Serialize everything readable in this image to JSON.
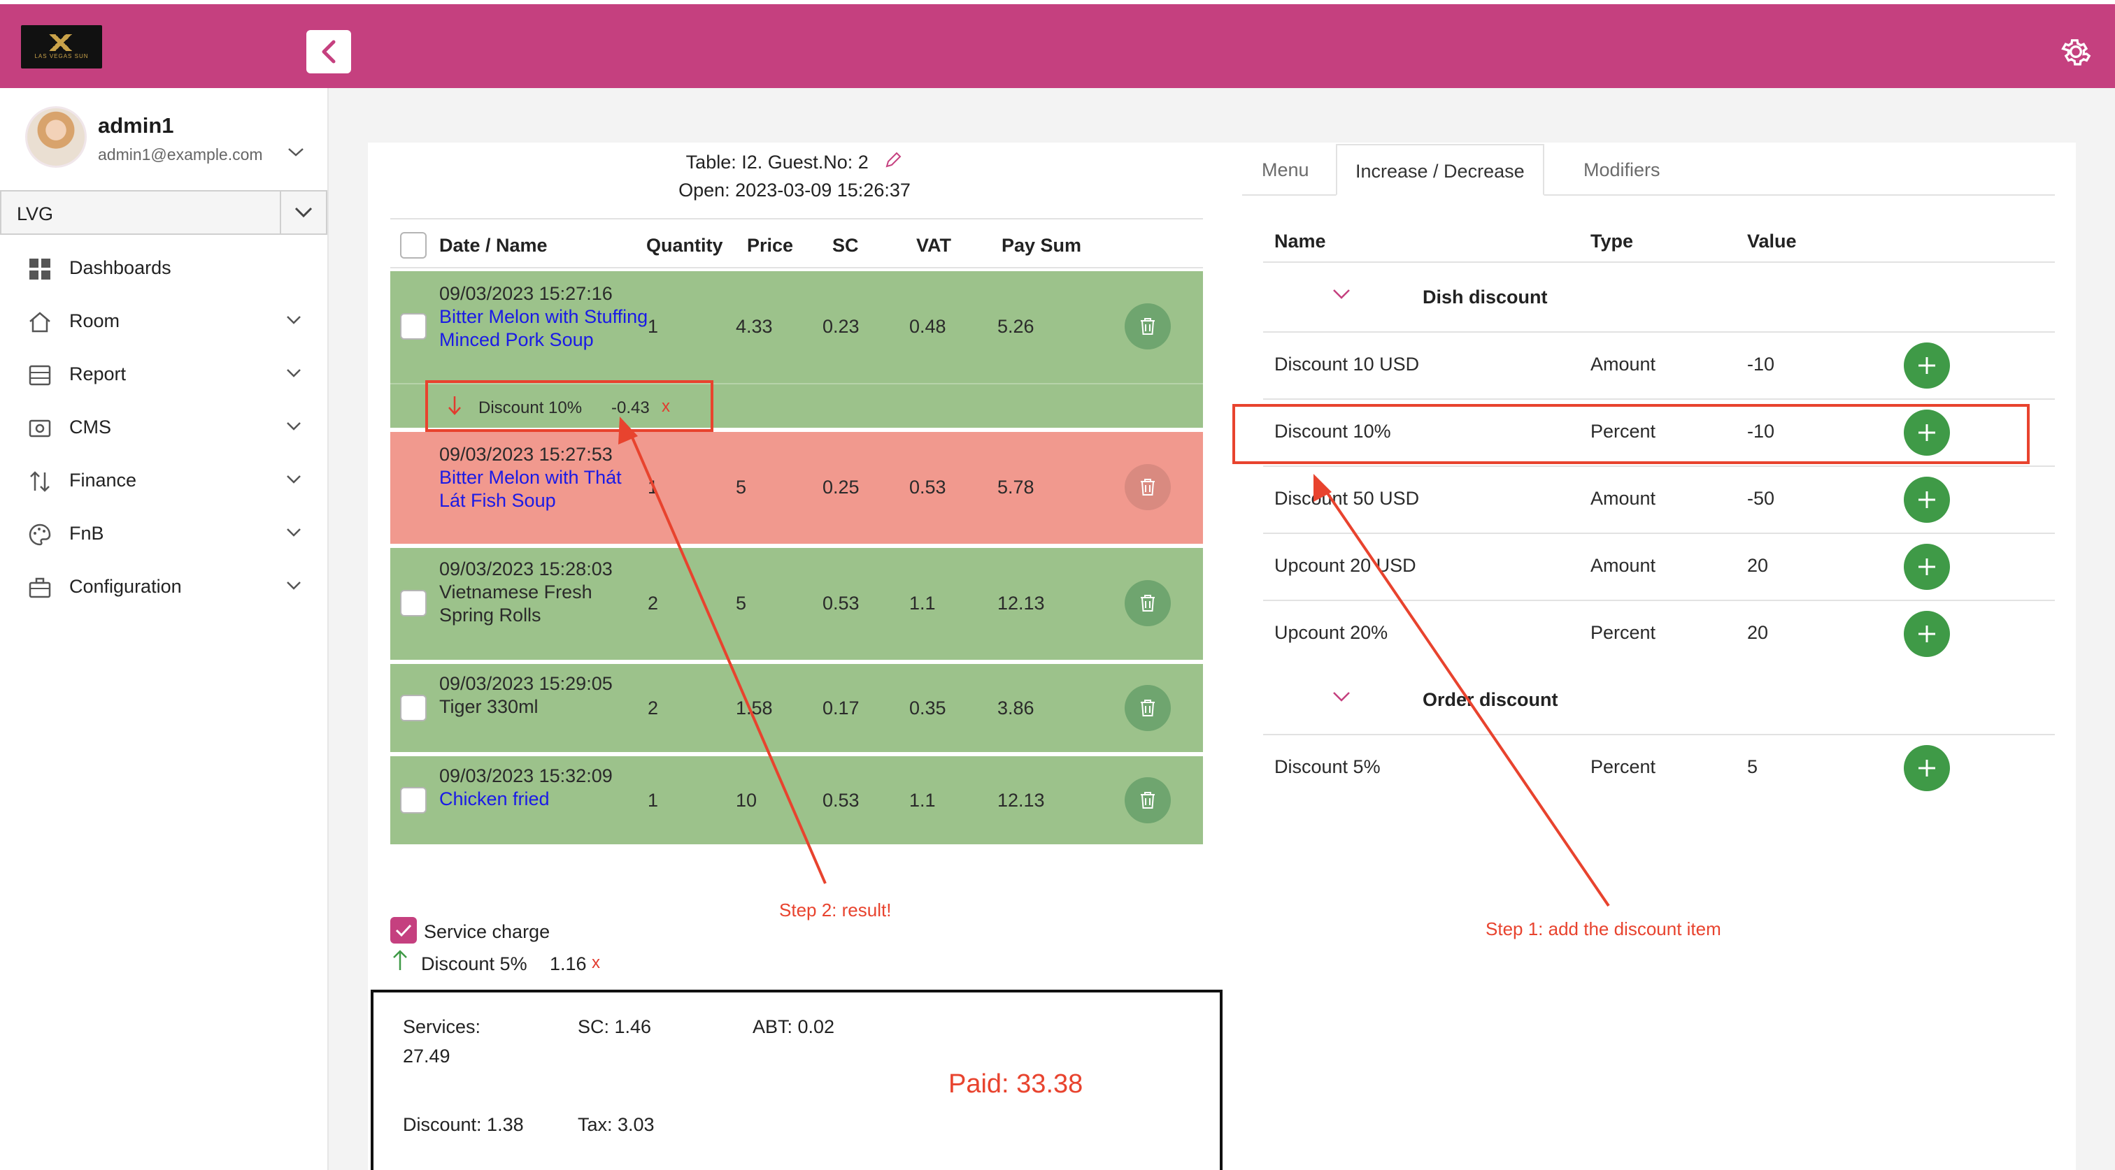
{
  "header": {
    "logo_text": "LAS VEGAS SUN",
    "colors": {
      "brand": "#c5407f",
      "row_green": "#9cc28b",
      "row_red": "#f1998e",
      "add_green": "#3f9a47",
      "annotation_red": "#e8432e",
      "link_blue": "#1a1ae6"
    }
  },
  "user": {
    "name": "admin1",
    "email": "admin1@example.com"
  },
  "org_select": {
    "value": "LVG"
  },
  "nav": [
    {
      "label": "Dashboards",
      "icon": "grid-icon"
    },
    {
      "label": "Room",
      "icon": "home-icon"
    },
    {
      "label": "Report",
      "icon": "report-icon"
    },
    {
      "label": "CMS",
      "icon": "image-icon"
    },
    {
      "label": "Finance",
      "icon": "sort-icon"
    },
    {
      "label": "FnB",
      "icon": "palette-icon"
    },
    {
      "label": "Configuration",
      "icon": "briefcase-icon"
    }
  ],
  "order": {
    "table_line": "Table: I2. Guest.No: 2",
    "open_line": "Open: 2023-03-09 15:26:37",
    "columns": [
      "Date / Name",
      "Quantity",
      "Price",
      "SC",
      "VAT",
      "Pay Sum"
    ],
    "items": [
      {
        "date": "09/03/2023 15:27:16",
        "name": "Bitter Melon with Stuffing Minced Pork Soup",
        "qty": "1",
        "price": "4.33",
        "sc": "0.23",
        "vat": "0.48",
        "sum": "5.26"
      },
      {
        "date": "09/03/2023 15:27:53",
        "name": "Bitter Melon with Thát Lát Fish Soup",
        "qty": "1",
        "price": "5",
        "sc": "0.25",
        "vat": "0.53",
        "sum": "5.78"
      },
      {
        "date": "09/03/2023 15:28:03",
        "name": "Vietnamese Fresh Spring Rolls",
        "qty": "2",
        "price": "5",
        "sc": "0.53",
        "vat": "1.1",
        "sum": "12.13"
      },
      {
        "date": "09/03/2023 15:29:05",
        "name": "Tiger 330ml",
        "qty": "2",
        "price": "1.58",
        "sc": "0.17",
        "vat": "0.35",
        "sum": "3.86"
      },
      {
        "date": "09/03/2023 15:32:09",
        "name": "Chicken fried",
        "qty": "1",
        "price": "10",
        "sc": "0.53",
        "vat": "1.1",
        "sum": "12.13"
      }
    ],
    "item_discount": {
      "label": "Discount 10%",
      "value": "-0.43",
      "remove": "x"
    },
    "service_charge_label": "Service charge",
    "order_discount": {
      "label": "Discount 5%",
      "value": "1.16",
      "remove": "x"
    }
  },
  "summary": {
    "services_label": "Services:",
    "services_value": "27.49",
    "sc": "SC: 1.46",
    "abt": "ABT: 0.02",
    "discount": "Discount: 1.38",
    "tax": "Tax: 3.03",
    "paid": "Paid: 33.38"
  },
  "tabs": [
    "Menu",
    "Increase / Decrease",
    "Modifiers"
  ],
  "discounts": {
    "columns": [
      "Name",
      "Type",
      "Value"
    ],
    "groups": [
      {
        "label": "Dish discount",
        "items": [
          {
            "name": "Discount 10 USD",
            "type": "Amount",
            "value": "-10"
          },
          {
            "name": "Discount 10%",
            "type": "Percent",
            "value": "-10"
          },
          {
            "name": "Discount 50 USD",
            "type": "Amount",
            "value": "-50"
          },
          {
            "name": "Upcount 20 USD",
            "type": "Amount",
            "value": "20"
          },
          {
            "name": "Upcount 20%",
            "type": "Percent",
            "value": "20"
          }
        ]
      },
      {
        "label": "Order discount",
        "items": [
          {
            "name": "Discount 5%",
            "type": "Percent",
            "value": "5"
          }
        ]
      }
    ]
  },
  "annotations": {
    "step1": "Step 1: add the discount item",
    "step2": "Step 2: result!"
  }
}
